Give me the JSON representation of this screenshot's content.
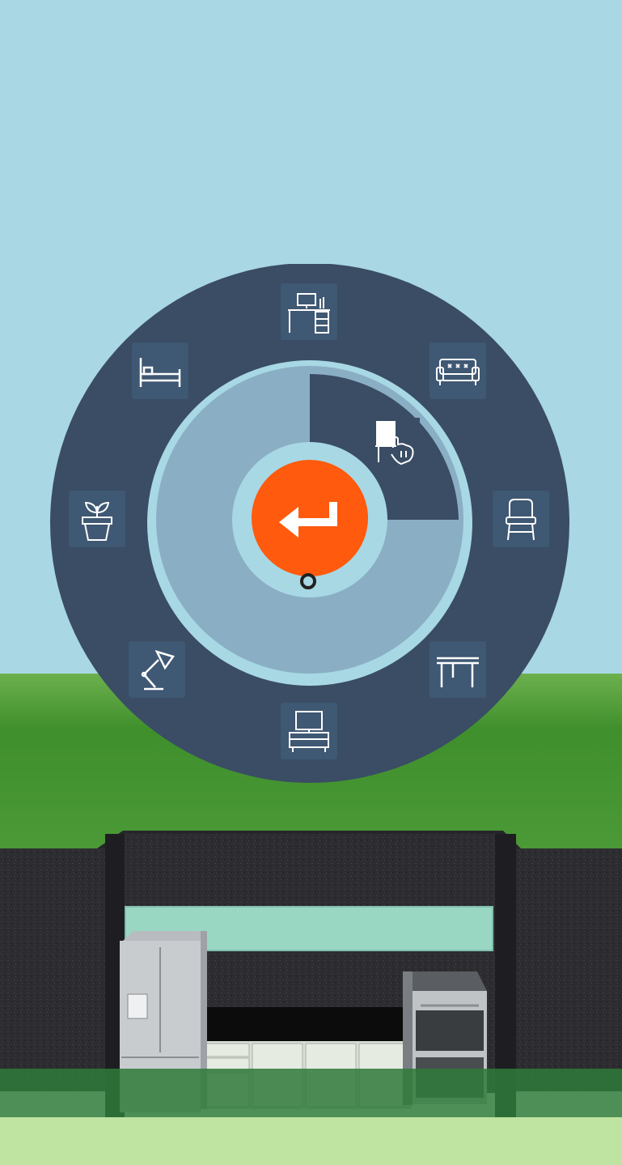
{
  "colors": {
    "sky": "#a9d7e3",
    "grass": "#4e9a3a",
    "menu_ring": "#3a4d64",
    "menu_inner": "#8aafc4",
    "accent_ring": "#a8d8e4",
    "confirm": "#ff5a0d",
    "wall": "#2a2a2e",
    "floor": "#bfe3a0"
  },
  "radial_menu": {
    "items": [
      {
        "id": "desk",
        "icon": "desk-icon"
      },
      {
        "id": "sofa",
        "icon": "sofa-icon"
      },
      {
        "id": "chair",
        "icon": "chair-icon"
      },
      {
        "id": "table",
        "icon": "table-icon"
      },
      {
        "id": "tv-stand",
        "icon": "tv-stand-icon"
      },
      {
        "id": "lamp",
        "icon": "lamp-icon"
      },
      {
        "id": "plant",
        "icon": "plant-icon"
      },
      {
        "id": "bed",
        "icon": "bed-icon"
      }
    ],
    "inner_selection": {
      "icon": "chair-tap-icon",
      "progress": 0.25
    },
    "confirm_icon": "return-arrow-icon"
  }
}
